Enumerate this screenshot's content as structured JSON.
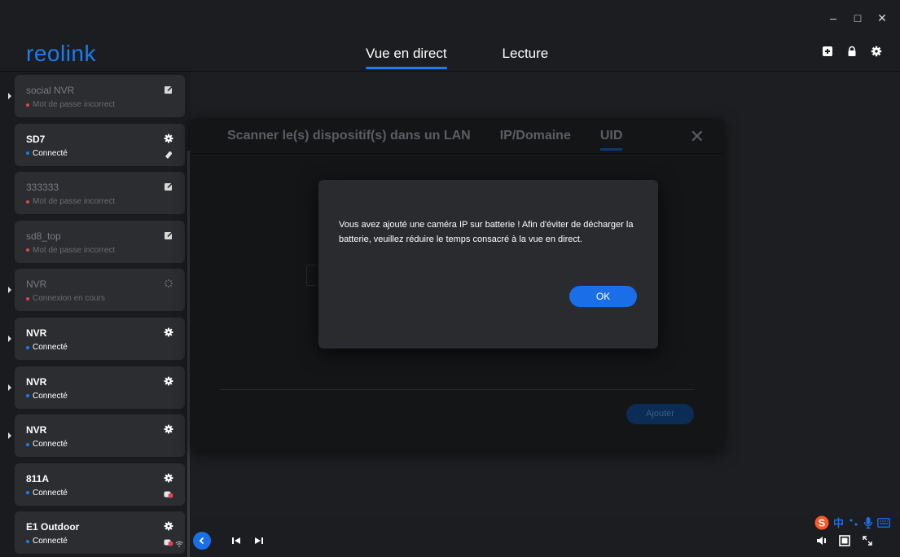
{
  "window": {
    "min_label": "–",
    "max_label": "□",
    "close_label": "✕"
  },
  "header": {
    "logo": "reolink",
    "tabs": [
      {
        "label": "Vue en direct",
        "active": true
      },
      {
        "label": "Lecture",
        "active": false
      }
    ],
    "icons": [
      "add-device-icon",
      "lock-icon",
      "settings-icon"
    ]
  },
  "sidebar": {
    "devices": [
      {
        "name": "social NVR",
        "status": "Mot de passe incorrect",
        "state": "error",
        "icon": "edit-icon",
        "expandable": true
      },
      {
        "name": "SD7",
        "status": "Connecté",
        "state": "ok",
        "icon": "settings-icon",
        "icon2": "battery-icon",
        "expandable": false
      },
      {
        "name": "333333",
        "status": "Mot de passe incorrect",
        "state": "error",
        "icon": "edit-icon",
        "expandable": false
      },
      {
        "name": "sd8_top",
        "status": "Mot de passe incorrect",
        "state": "error",
        "icon": "edit-icon",
        "expandable": false
      },
      {
        "name": "NVR",
        "status": "Connexion en cours",
        "state": "connecting",
        "icon": "spinner-icon",
        "expandable": true
      },
      {
        "name": "NVR",
        "status": "Connecté",
        "state": "ok",
        "icon": "settings-icon",
        "expandable": true
      },
      {
        "name": "NVR",
        "status": "Connecté",
        "state": "ok",
        "icon": "settings-icon",
        "expandable": true
      },
      {
        "name": "NVR",
        "status": "Connecté",
        "state": "ok",
        "icon": "settings-icon",
        "expandable": true
      },
      {
        "name": "811A",
        "status": "Connecté",
        "state": "ok",
        "icon": "settings-icon",
        "icon2": "camera-alert-icon",
        "expandable": false
      },
      {
        "name": "E1 Outdoor",
        "status": "Connecté",
        "state": "ok",
        "icon": "settings-icon",
        "icon2": "camera-alert-icon",
        "icon3": "wifi-icon",
        "expandable": false
      }
    ]
  },
  "add_dialog": {
    "tabs": [
      {
        "label": "Scanner le(s) dispositif(s) dans un LAN",
        "active": false
      },
      {
        "label": "IP/Domaine",
        "active": false
      },
      {
        "label": "UID",
        "active": true
      }
    ],
    "close_label": "✕",
    "add_button": "Ajouter"
  },
  "alert": {
    "message": "Vous avez ajouté une caméra IP sur batterie ! Afin d'éviter de décharger la batterie, veuillez réduire le temps consacré à la vue en direct.",
    "ok_label": "OK"
  },
  "ime": {
    "label": "中"
  },
  "colors": {
    "accent": "#1a6fe8",
    "error": "#e0454b",
    "connected": "#1a7cf0"
  }
}
